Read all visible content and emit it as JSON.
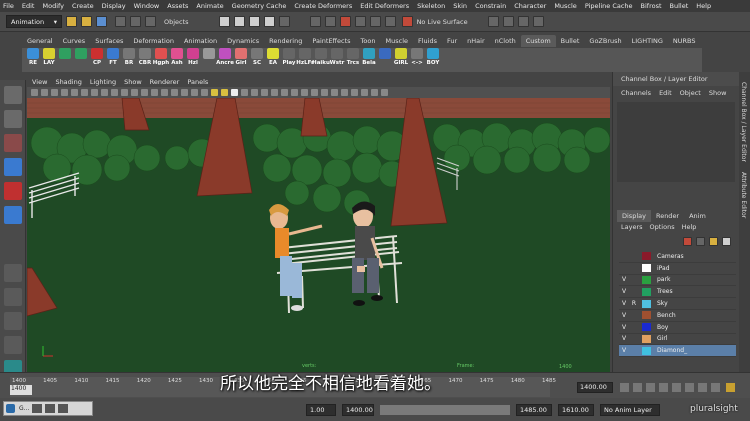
{
  "menus": [
    "File",
    "Edit",
    "Modify",
    "Create",
    "Display",
    "Window",
    "Assets",
    "Animate",
    "Geometry Cache",
    "Create Deformers",
    "Edit Deformers",
    "Skeleton",
    "Skin",
    "Constrain",
    "Character",
    "Muscle",
    "Pipeline Cache",
    "Bifrost",
    "Bullet",
    "Help"
  ],
  "status": {
    "menuset": "Animation",
    "selection_mode": "Objects",
    "live_surface": "No Live Surface"
  },
  "shelf_tabs": [
    "General",
    "Curves",
    "Surfaces",
    "Deformation",
    "Animation",
    "Dynamics",
    "Rendering",
    "PaintEffects",
    "Toon",
    "Muscle",
    "Fluids",
    "Fur",
    "nHair",
    "nCloth",
    "Custom",
    "Bullet",
    "GoZBrush",
    "LIGHTING",
    "NURBS"
  ],
  "active_shelf_tab": "Custom",
  "shelf_buttons": [
    {
      "label": "RE",
      "color": "#3b8fd8"
    },
    {
      "label": "LAY",
      "color": "#d8d030"
    },
    {
      "label": "",
      "color": "#2fa060"
    },
    {
      "label": "",
      "color": "#2fa060"
    },
    {
      "label": "CP",
      "color": "#cc3030"
    },
    {
      "label": "FT",
      "color": "#3a7ad0"
    },
    {
      "label": "BR",
      "color": "#777777"
    },
    {
      "label": "CBR",
      "color": "#7a7a7a"
    },
    {
      "label": "Hgph",
      "color": "#e05050"
    },
    {
      "label": "Ash",
      "color": "#e05090"
    },
    {
      "label": "Hzl",
      "color": "#d04090"
    },
    {
      "label": "",
      "color": "#999999"
    },
    {
      "label": "Ancre",
      "color": "#c050c0"
    },
    {
      "label": "Girl",
      "color": "#e07070"
    },
    {
      "label": "SC",
      "color": "#777777"
    },
    {
      "label": "EA",
      "color": "#dddd33"
    },
    {
      "label": "Play",
      "color": "#666666"
    },
    {
      "label": "HzLFr",
      "color": "#666666"
    },
    {
      "label": "Haiku",
      "color": "#666666"
    },
    {
      "label": "Wstr",
      "color": "#666666"
    },
    {
      "label": "Trcs",
      "color": "#666666"
    },
    {
      "label": "Bela",
      "color": "#30a0c0"
    },
    {
      "label": "",
      "color": "#3a6ac0"
    },
    {
      "label": "GIRL",
      "color": "#d0d030"
    },
    {
      "label": "<->",
      "color": "#777777"
    },
    {
      "label": "BOY",
      "color": "#30a0d0"
    }
  ],
  "panel_menus": [
    "View",
    "Shading",
    "Lighting",
    "Show",
    "Renderer",
    "Panels"
  ],
  "channel_box": {
    "title": "Channel Box / Layer Editor",
    "menus": [
      "Channels",
      "Edit",
      "Object",
      "Show"
    ]
  },
  "layer_editor": {
    "tabs": [
      "Display",
      "Render",
      "Anim"
    ],
    "active_tab": "Display",
    "menus": [
      "Layers",
      "Options",
      "Help"
    ],
    "layers": [
      {
        "v": "",
        "r": "",
        "name": "Cameras",
        "color": "#8a1a2a"
      },
      {
        "v": "",
        "r": "",
        "name": "iPad",
        "color": "#ffffff"
      },
      {
        "v": "V",
        "r": "",
        "name": "park",
        "color": "#2aa040"
      },
      {
        "v": "V",
        "r": "",
        "name": "Trees",
        "color": "#22a060"
      },
      {
        "v": "V",
        "r": "R",
        "name": "Sky",
        "color": "#50c0e0"
      },
      {
        "v": "V",
        "r": "",
        "name": "Bench",
        "color": "#a05030"
      },
      {
        "v": "V",
        "r": "",
        "name": "Boy",
        "color": "#1a2ad0"
      },
      {
        "v": "V",
        "r": "",
        "name": "Girl",
        "color": "#e0a060"
      },
      {
        "v": "V",
        "r": "",
        "name": "Diamond_",
        "color": "#40c0e0"
      }
    ]
  },
  "side_tabs": [
    "Channel Box / Layer Editor",
    "Attribute Editor"
  ],
  "timeline": {
    "ticks": [
      "1400",
      "1405",
      "1410",
      "1415",
      "1420",
      "1425",
      "1430",
      "1435",
      "1440",
      "1445",
      "1450",
      "1455",
      "1460",
      "1465",
      "1470",
      "1475",
      "1480",
      "1485"
    ],
    "current_frame": "1400",
    "end_value": "1400.00"
  },
  "range": {
    "start": "1.00",
    "range_start": "1400.00",
    "range_end": "1485.00",
    "end": "1610.00",
    "anim_layer": "No Anim Layer"
  },
  "hud": {
    "frame_label": "1400",
    "info1": "verts:",
    "info2": "Frame:"
  },
  "taskbar": {
    "label": "G..."
  },
  "subtitle": "所以他完全不相信地看着她。",
  "watermark": "pluralsight"
}
